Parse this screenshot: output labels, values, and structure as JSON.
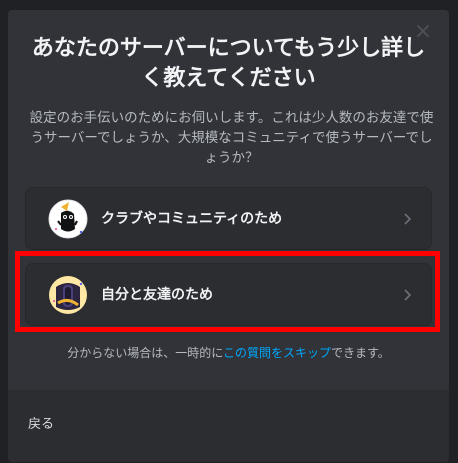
{
  "modal": {
    "close_label": "×",
    "title": "あなたのサーバーについてもう少し詳しく教えてください",
    "subtitle": "設定のお手伝いのためにお伺いします。これは少人数のお友達で使うサーバーでしょうか、大規模なコミュニティで使うサーバーでしょうか？",
    "options": [
      {
        "label": "クラブやコミュニティのため",
        "icon": "club-community-icon"
      },
      {
        "label": "自分と友達のため",
        "icon": "me-and-friends-icon"
      }
    ],
    "skip": {
      "prefix": "分からない場合は、一時的に",
      "link": "この質問をスキップ",
      "suffix": "できます。"
    },
    "back_label": "戻る"
  },
  "colors": {
    "modal_bg": "#313338",
    "option_bg": "#2b2d31",
    "link": "#00a8fc",
    "highlight": "#ff0000"
  }
}
